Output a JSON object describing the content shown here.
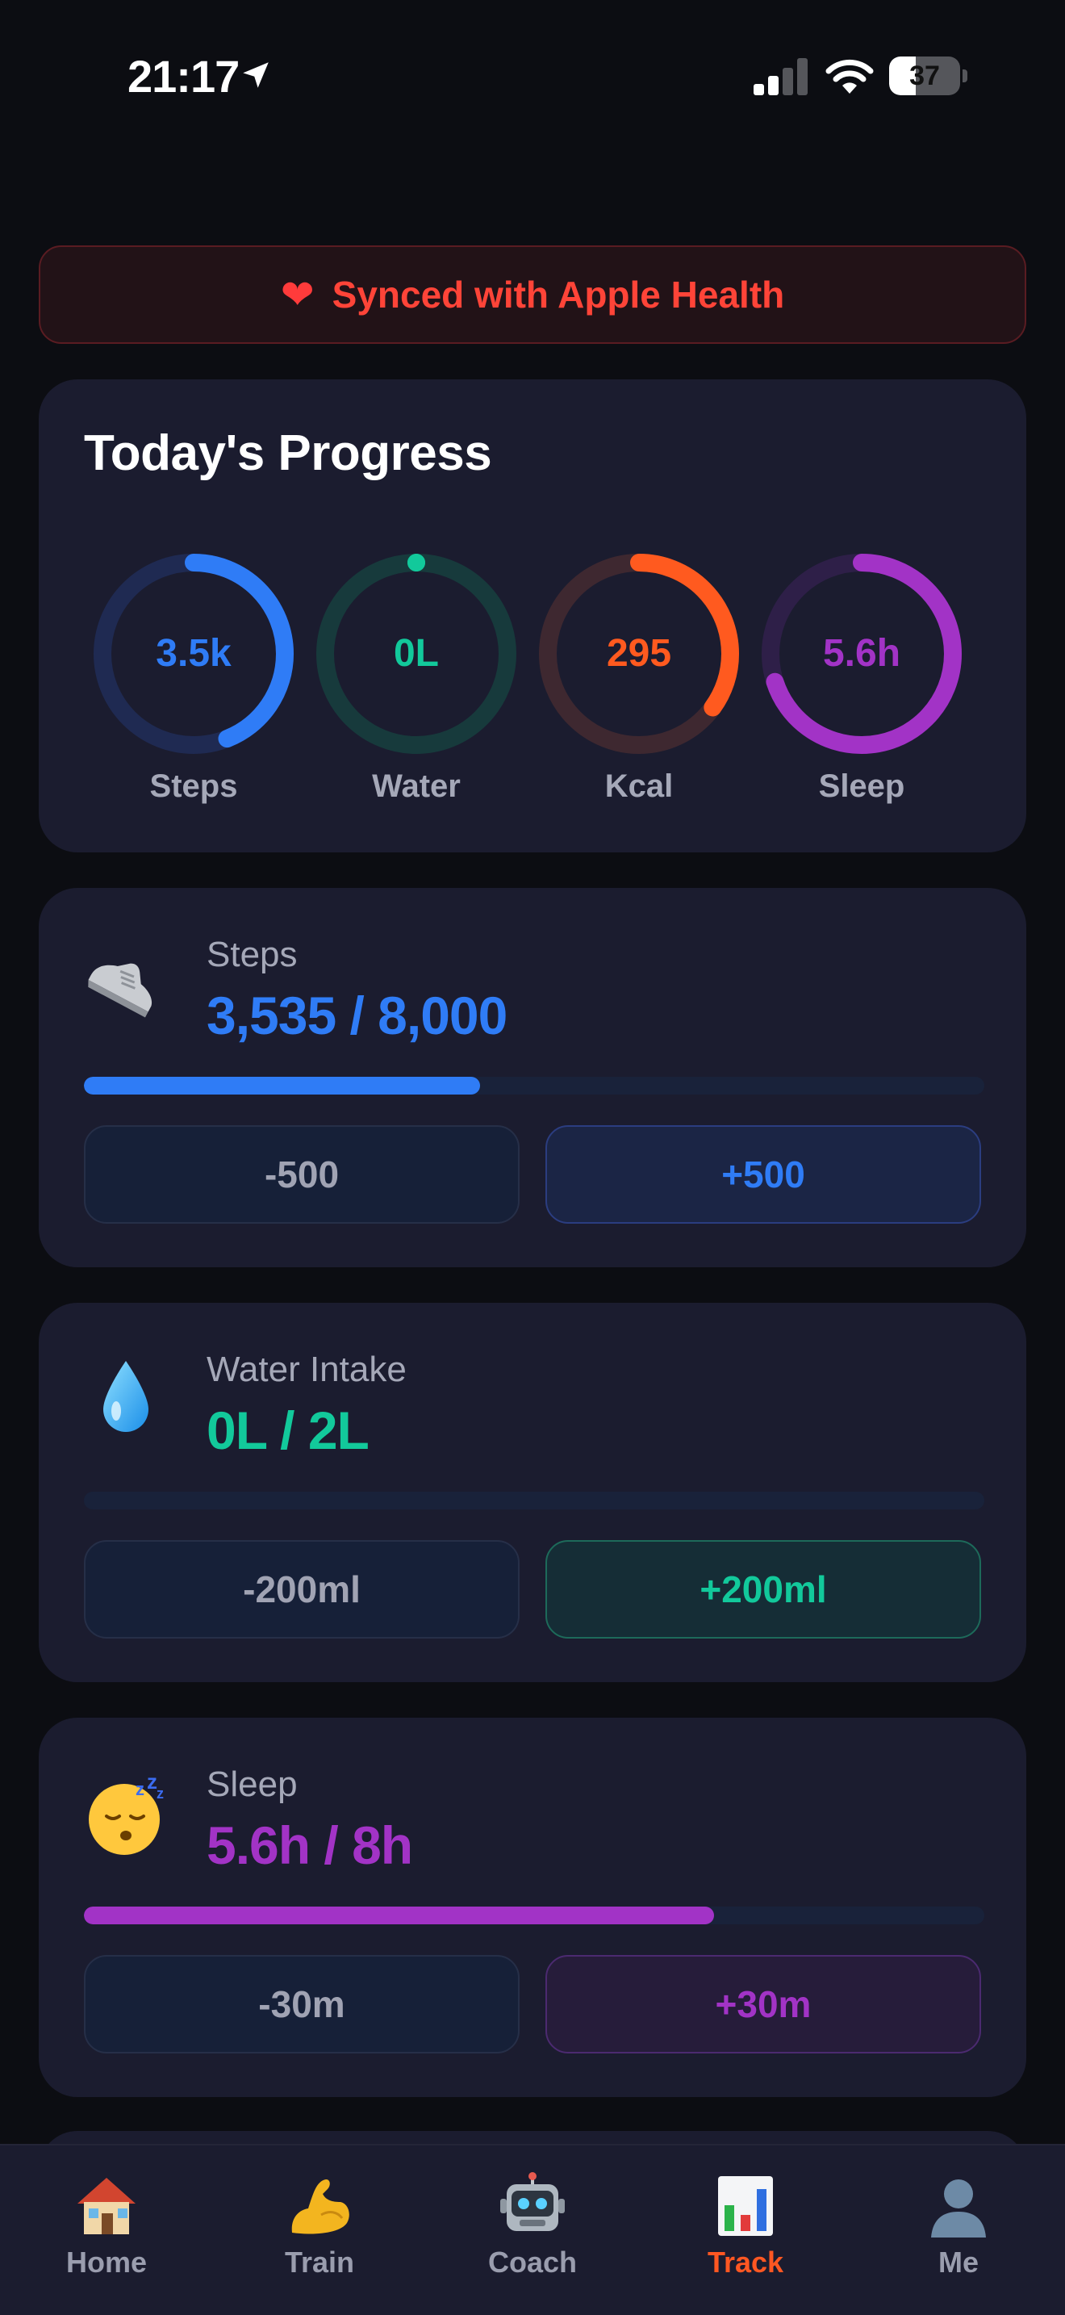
{
  "status_bar": {
    "time": "21:17",
    "battery_percent": "37",
    "battery_level": 0.37,
    "signal_bars_active": 2,
    "signal_bars_total": 4
  },
  "sync_banner": {
    "icon": "heart-icon",
    "text": "Synced with Apple Health"
  },
  "progress": {
    "title": "Today's Progress",
    "rings": [
      {
        "label": "Steps",
        "value": "3.5k",
        "fraction": 0.44,
        "color": "#2f7cf6",
        "track": "#1f2a52"
      },
      {
        "label": "Water",
        "value": "0L",
        "fraction": 0.0,
        "color": "#12c99b",
        "track": "#173a3c"
      },
      {
        "label": "Kcal",
        "value": "295",
        "fraction": 0.35,
        "color": "#ff5a1f",
        "track": "#3e2830"
      },
      {
        "label": "Sleep",
        "value": "5.6h",
        "fraction": 0.7,
        "color": "#a233c6",
        "track": "#2e1f48"
      }
    ]
  },
  "steps": {
    "icon": "sneaker-icon",
    "label": "Steps",
    "value": "3,535 / 8,000",
    "fraction": 0.44,
    "color": "#2f7cf6",
    "minus_label": "-500",
    "plus_label": "+500",
    "plus_bg": "#1b2545",
    "plus_border": "#2b3d80"
  },
  "water": {
    "icon": "droplet-icon",
    "label": "Water Intake",
    "value": "0L / 2L",
    "fraction": 0.0,
    "color": "#12c99b",
    "minus_label": "-200ml",
    "plus_label": "+200ml",
    "plus_bg": "#152d36",
    "plus_border": "#1d6a5a"
  },
  "sleep": {
    "icon": "sleeping-face-icon",
    "label": "Sleep",
    "value": "5.6h / 8h",
    "fraction": 0.7,
    "color": "#a233c6",
    "minus_label": "-30m",
    "plus_label": "+30m",
    "plus_bg": "#261c3a",
    "plus_border": "#4b2a70"
  },
  "tabs": [
    {
      "label": "Home",
      "icon": "house-icon",
      "active": false
    },
    {
      "label": "Train",
      "icon": "flexed-biceps-icon",
      "active": false
    },
    {
      "label": "Coach",
      "icon": "robot-icon",
      "active": false
    },
    {
      "label": "Track",
      "icon": "bar-chart-icon",
      "active": true
    },
    {
      "label": "Me",
      "icon": "person-silhouette-icon",
      "active": false
    }
  ]
}
